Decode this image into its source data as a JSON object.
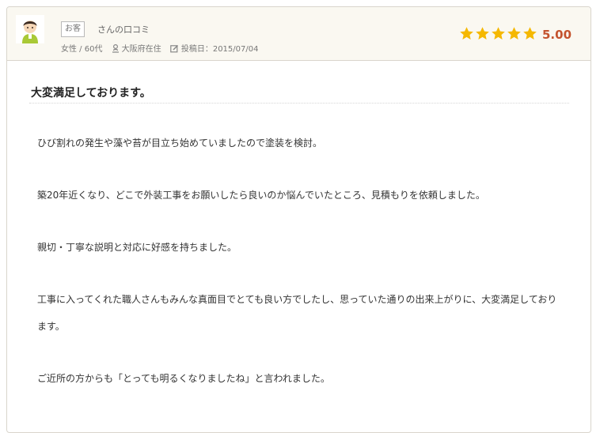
{
  "review": {
    "tag": "お客",
    "reviewer": "さんの口コミ",
    "gender_age": "女性 / 60代",
    "location": "大阪府在住",
    "posted": "投稿日：2015/07/04",
    "rating": 5,
    "score": "5.00",
    "title": "大変満足しております。",
    "paragraphs": [
      "ひび割れの発生や藻や苔が目立ち始めていましたので塗装を検討。",
      "築20年近くなり、どこで外装工事をお願いしたら良いのか悩んでいたところ、見積もりを依頼しました。",
      "親切・丁寧な説明と対応に好感を持ちました。",
      "工事に入ってくれた職人さんもみんな真面目でとても良い方でしたし、思っていた通りの出来上がりに、大変満足しております。",
      "ご近所の方からも「とっても明るくなりましたね」と言われました。"
    ]
  },
  "icons": {
    "avatar": "user-avatar-icon",
    "location": "person-pin-icon",
    "posted": "edit-icon",
    "star": "star-icon"
  },
  "colors": {
    "header_bg": "#faf8f1",
    "star": "#f5b800",
    "score": "#c4532e",
    "border": "#d9d5cc"
  }
}
